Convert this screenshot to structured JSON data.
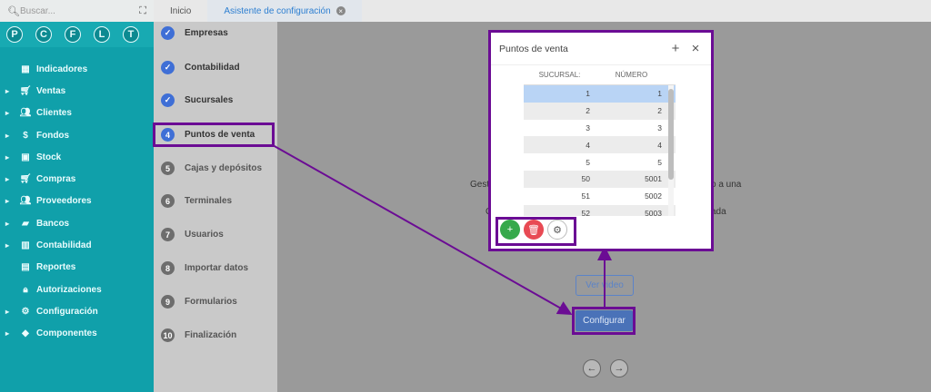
{
  "sidebar": {
    "search_placeholder": "Buscar...",
    "avatars": [
      "P",
      "C",
      "F",
      "L",
      "T"
    ],
    "items": [
      {
        "label": "Indicadores",
        "icon": "dashboard-icon",
        "caret": false
      },
      {
        "label": "Ventas",
        "icon": "cart-icon",
        "caret": true
      },
      {
        "label": "Clientes",
        "icon": "people-icon",
        "caret": true
      },
      {
        "label": "Fondos",
        "icon": "dollar-icon",
        "caret": true
      },
      {
        "label": "Stock",
        "icon": "box-icon",
        "caret": true
      },
      {
        "label": "Compras",
        "icon": "cart-plus-icon",
        "caret": true
      },
      {
        "label": "Proveedores",
        "icon": "people-icon",
        "caret": true
      },
      {
        "label": "Bancos",
        "icon": "briefcase-icon",
        "caret": true
      },
      {
        "label": "Contabilidad",
        "icon": "book-icon",
        "caret": true
      },
      {
        "label": "Reportes",
        "icon": "report-icon",
        "caret": false
      },
      {
        "label": "Autorizaciones",
        "icon": "lock-icon",
        "caret": false
      },
      {
        "label": "Configuración",
        "icon": "gears-icon",
        "caret": true
      },
      {
        "label": "Componentes",
        "icon": "tag-icon",
        "caret": true
      }
    ]
  },
  "tabs": [
    {
      "label": "Inicio",
      "active": false
    },
    {
      "label": "Asistente de configuración",
      "active": true
    }
  ],
  "steps": [
    {
      "num": "✓",
      "label": "Empresas",
      "state": "done"
    },
    {
      "num": "✓",
      "label": "Contabilidad",
      "state": "done"
    },
    {
      "num": "✓",
      "label": "Sucursales",
      "state": "done"
    },
    {
      "num": "4",
      "label": "Puntos de venta",
      "state": "current"
    },
    {
      "num": "5",
      "label": "Cajas y depósitos",
      "state": "todo"
    },
    {
      "num": "6",
      "label": "Terminales",
      "state": "todo"
    },
    {
      "num": "7",
      "label": "Usuarios",
      "state": "todo"
    },
    {
      "num": "8",
      "label": "Importar datos",
      "state": "todo"
    },
    {
      "num": "9",
      "label": "Formularios",
      "state": "todo"
    },
    {
      "num": "10",
      "label": "Finalización",
      "state": "todo"
    }
  ],
  "main": {
    "text_fragments": [
      "Gest",
      "o a una",
      "C",
      "ada"
    ],
    "video_button": "Ver video",
    "configure_button": "Configurar",
    "prev_icon": "←",
    "next_icon": "→"
  },
  "modal": {
    "title": "Puntos de venta",
    "add_icon": "+",
    "close_icon": "×",
    "columns": [
      "SUCURSAL:",
      "NÚMERO"
    ],
    "rows": [
      [
        "1",
        "1"
      ],
      [
        "2",
        "2"
      ],
      [
        "3",
        "3"
      ],
      [
        "4",
        "4"
      ],
      [
        "5",
        "5"
      ],
      [
        "50",
        "5001"
      ],
      [
        "51",
        "5002"
      ],
      [
        "52",
        "5003"
      ]
    ],
    "selected_row": 0,
    "actions": [
      "+",
      "🗑",
      "⚙"
    ]
  },
  "colors": {
    "sidebar": "#10a0aa",
    "accent": "#3f6fd6",
    "highlight": "#6b0c94",
    "add": "#36a94b",
    "delete": "#e84a54"
  }
}
